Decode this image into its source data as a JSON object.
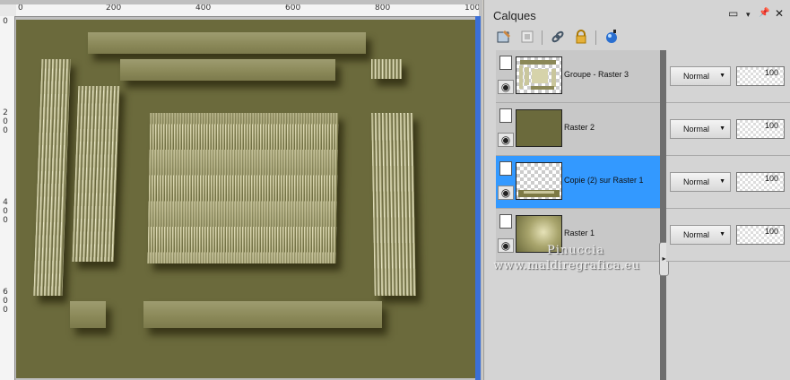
{
  "ruler": {
    "top_labels": [
      "0",
      "200",
      "400",
      "600",
      "800",
      "100"
    ],
    "left_labels": [
      "0",
      "2",
      "0",
      "0",
      "4",
      "0",
      "0",
      "6",
      "0",
      "0"
    ]
  },
  "panel": {
    "title": "Calques",
    "controls": [
      "▭",
      "▾",
      "📌",
      "✕"
    ]
  },
  "toolbar": {
    "icons": [
      "new-layer-icon",
      "raster-layer-icon",
      "link-icon",
      "lock-icon",
      "properties-icon"
    ]
  },
  "layers": [
    {
      "name": "Groupe - Raster 3",
      "blend": "Normal",
      "opacity": "100",
      "selected": false
    },
    {
      "name": "Raster 2",
      "blend": "Normal",
      "opacity": "100",
      "selected": false
    },
    {
      "name": "Copie (2) sur Raster 1",
      "blend": "Normal",
      "opacity": "100",
      "selected": true
    },
    {
      "name": "Raster 1",
      "blend": "Normal",
      "opacity": "100",
      "selected": false
    }
  ],
  "watermark": {
    "line1": "Pinuccia",
    "line2": "www.maldiregrafica.eu"
  },
  "colors": {
    "canvas_bg": "#6b6a3c",
    "selected_row": "#3399ff",
    "raster2_fill": "#6b6a3c"
  }
}
